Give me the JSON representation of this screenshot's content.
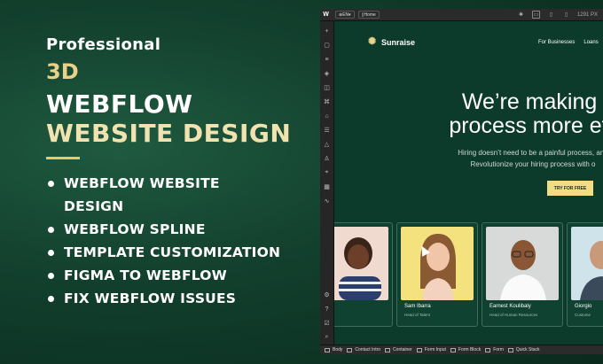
{
  "promo": {
    "line1": "Professional",
    "line2": "3D",
    "line3": "WEBFLOW",
    "line4": "WEBSITE DESIGN",
    "bullets": [
      "WEBFLOW WEBSITE",
      "DESIGN",
      "WEBFLOW SPLINE",
      "TEMPLATE CUSTOMIZATION",
      "FIGMA TO WEBFLOW",
      "FIX WEBFLOW ISSUES"
    ]
  },
  "editor": {
    "locale": "EN",
    "page": "Home",
    "width_readout": "1291 PX",
    "breadcrumbs": [
      "Body",
      "Contact Intro",
      "Container",
      "Form Input",
      "Form Block",
      "Form",
      "Quick Stack"
    ]
  },
  "site": {
    "brand": "Sunraise",
    "nav": [
      "For Businesses",
      "Loans"
    ],
    "hero_line1": "We’re making th",
    "hero_line2": "process more effici",
    "sub_line1": "Hiring doesn’t need to be a painful process, and",
    "sub_line2": "Revolutionize your hiring process with o",
    "cta": "TRY FOR FREE",
    "cards": [
      {
        "name": "illiams",
        "role": "ector"
      },
      {
        "name": "Sam Ibarra",
        "role": "Head of Talent"
      },
      {
        "name": "Earnest Koulibaly",
        "role": "Head of Human Resources"
      },
      {
        "name": "Giorgio",
        "role": "Custome"
      }
    ]
  },
  "colors": {
    "background": "#123f2d",
    "accent_gold": "#ead18a",
    "cta": "#f2dd86",
    "canvas": "#0d3b2b"
  }
}
